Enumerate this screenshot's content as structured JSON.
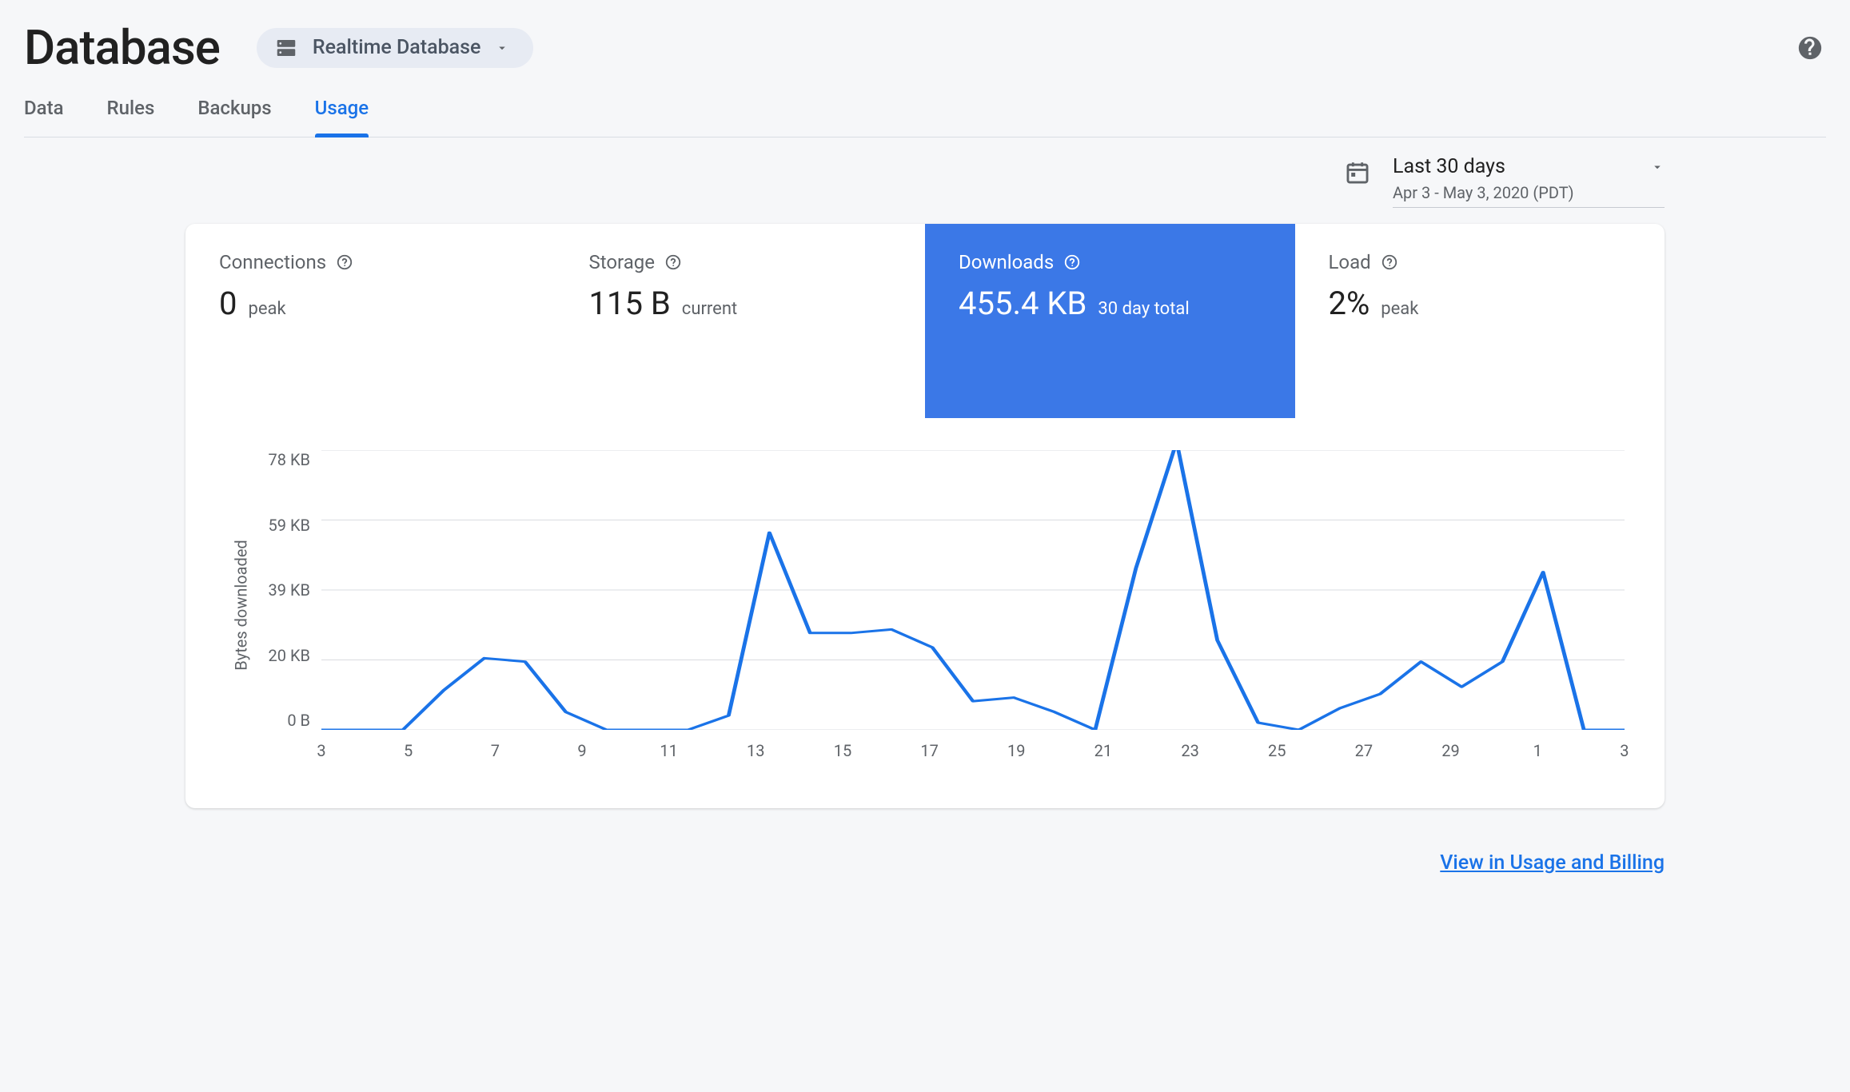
{
  "header": {
    "title": "Database",
    "instance_label": "Realtime Database"
  },
  "tabs": [
    "Data",
    "Rules",
    "Backups",
    "Usage"
  ],
  "active_tab_index": 3,
  "date_range": {
    "label": "Last 30 days",
    "sub": "Apr 3 - May 3, 2020 (PDT)"
  },
  "metrics": [
    {
      "label": "Connections",
      "value": "0",
      "suffix": "peak",
      "selected": false
    },
    {
      "label": "Storage",
      "value": "115 B",
      "suffix": "current",
      "selected": false
    },
    {
      "label": "Downloads",
      "value": "455.4 KB",
      "suffix": "30 day total",
      "selected": true
    },
    {
      "label": "Load",
      "value": "2%",
      "suffix": "peak",
      "selected": false
    }
  ],
  "chart_data": {
    "type": "line",
    "ylabel": "Bytes downloaded",
    "yticks": [
      "78 KB",
      "59 KB",
      "39 KB",
      "20 KB",
      "0 B"
    ],
    "ylim": [
      0,
      78
    ],
    "xticks": [
      "3",
      "5",
      "7",
      "9",
      "11",
      "13",
      "15",
      "17",
      "19",
      "21",
      "23",
      "25",
      "27",
      "29",
      "1",
      "3"
    ],
    "x": [
      3,
      4,
      5,
      6,
      7,
      8,
      9,
      10,
      11,
      12,
      13,
      14,
      15,
      16,
      17,
      18,
      19,
      20,
      21,
      22,
      23,
      24,
      25,
      26,
      27,
      28,
      29,
      30,
      1,
      2,
      3
    ],
    "values": [
      0,
      0,
      0,
      11,
      20,
      19,
      5,
      0,
      0,
      0,
      4,
      55,
      27,
      27,
      28,
      23,
      8,
      9,
      5,
      0,
      45,
      80,
      25,
      2,
      0,
      6,
      10,
      19,
      12,
      19,
      44,
      0,
      0
    ]
  },
  "footer_link": "View in Usage and Billing"
}
